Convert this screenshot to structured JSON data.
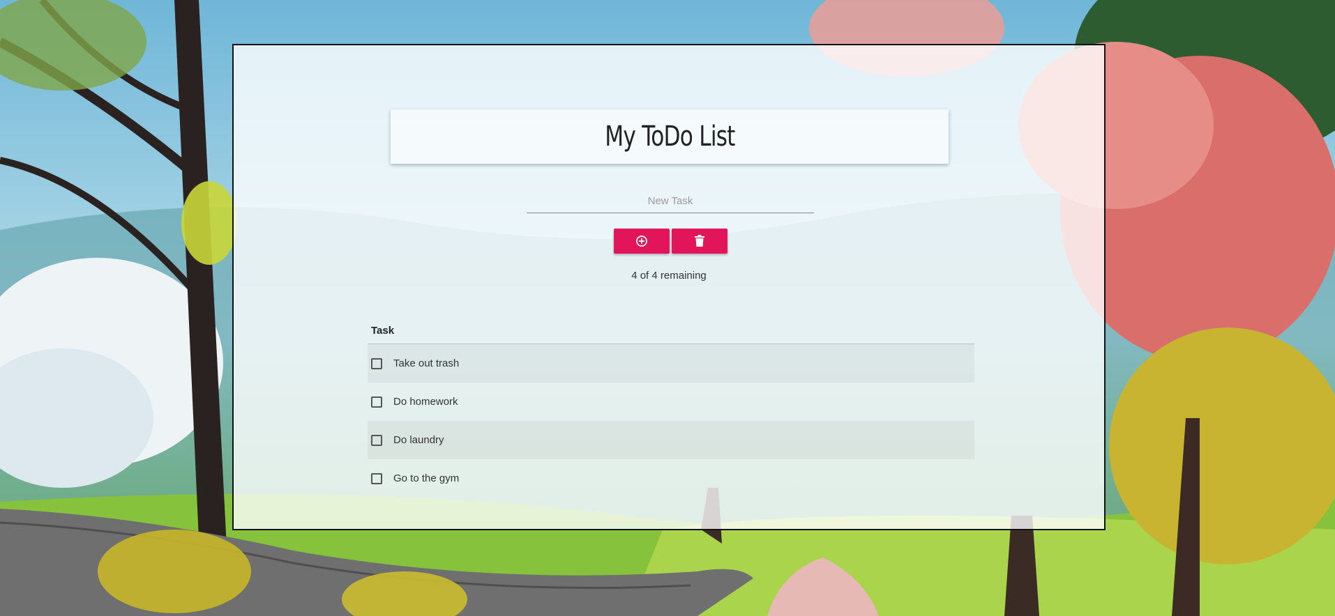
{
  "app": {
    "title": "My ToDo List"
  },
  "new_task": {
    "value": "",
    "placeholder": "New Task"
  },
  "toolbar": {
    "add_icon": "plus-circle-icon",
    "delete_icon": "trash-icon"
  },
  "status": {
    "remaining_text": "4 of 4 remaining"
  },
  "table": {
    "header": "Task",
    "rows": [
      {
        "label": "Take out trash",
        "checked": false
      },
      {
        "label": "Do homework",
        "checked": false
      },
      {
        "label": "Do laundry",
        "checked": false
      },
      {
        "label": "Go to the gym",
        "checked": false
      }
    ]
  },
  "colors": {
    "accent": "#e3155a",
    "panel_border": "#111111"
  }
}
